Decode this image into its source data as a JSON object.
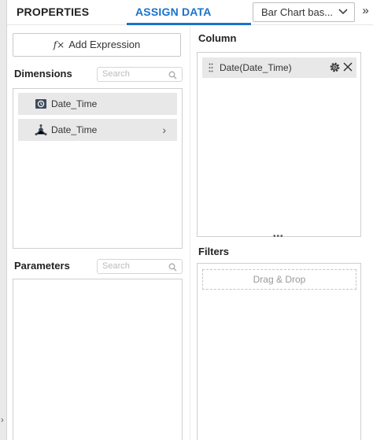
{
  "tabs": {
    "properties": "PROPERTIES",
    "assign_data": "ASSIGN DATA"
  },
  "widget_dropdown": {
    "value": "Bar Chart bas..."
  },
  "collapse_glyph": "»",
  "sidebar_arrow": "›",
  "add_expression": {
    "icon": "f×",
    "label": "Add Expression"
  },
  "dimensions": {
    "title": "Dimensions",
    "search_placeholder": "Search",
    "items": [
      {
        "label": "Date_Time",
        "icon": "clock-icon"
      },
      {
        "label": "Date_Time",
        "icon": "hierarchy-icon",
        "expand": "›"
      }
    ]
  },
  "parameters": {
    "title": "Parameters",
    "search_placeholder": "Search"
  },
  "column": {
    "title": "Column",
    "items": [
      {
        "label": "Date(Date_Time)"
      }
    ]
  },
  "resize_dots": "•••",
  "filters": {
    "title": "Filters",
    "dropzone": "Drag & Drop"
  },
  "colors": {
    "accent": "#1a73c9",
    "item_bg": "#e8e8e8",
    "border": "#cfcfcf"
  }
}
